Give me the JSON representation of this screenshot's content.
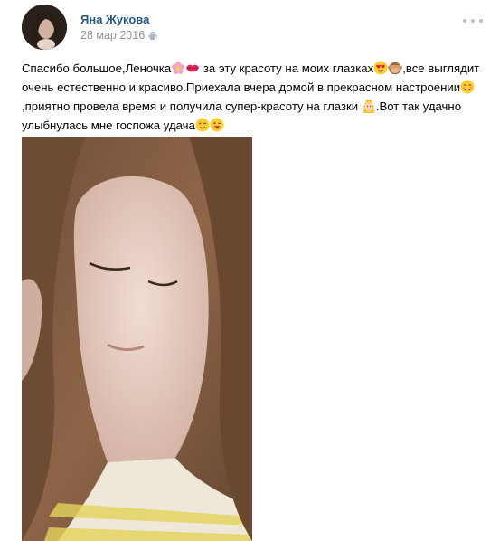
{
  "post": {
    "author": "Яна Жукова",
    "date": "28 мар 2016",
    "text_parts": [
      "Спасибо большое,Леночка",
      " за эту красоту на моих глазках",
      ",все выглядит очень естественно и красиво.Приехала вчера домой в прекрасном настроении",
      ",приятно провела время и получила супер-красоту на глазки ",
      ".Вот так удачно улыбнулась мне госпожа удача"
    ],
    "icons": {
      "platform": "android-icon",
      "menu": "more-dots-icon",
      "emojis": [
        "flower-emoji",
        "kiss-lips-emoji",
        "heart-eyes-emoji",
        "see-no-evil-monkey-emoji",
        "smiling-blush-emoji",
        "princess-emoji",
        "winking-emoji",
        "tongue-out-emoji"
      ]
    },
    "colors": {
      "author_link": "#2a5885",
      "date": "#939393",
      "menu_dots": "#b8c1cc"
    }
  }
}
